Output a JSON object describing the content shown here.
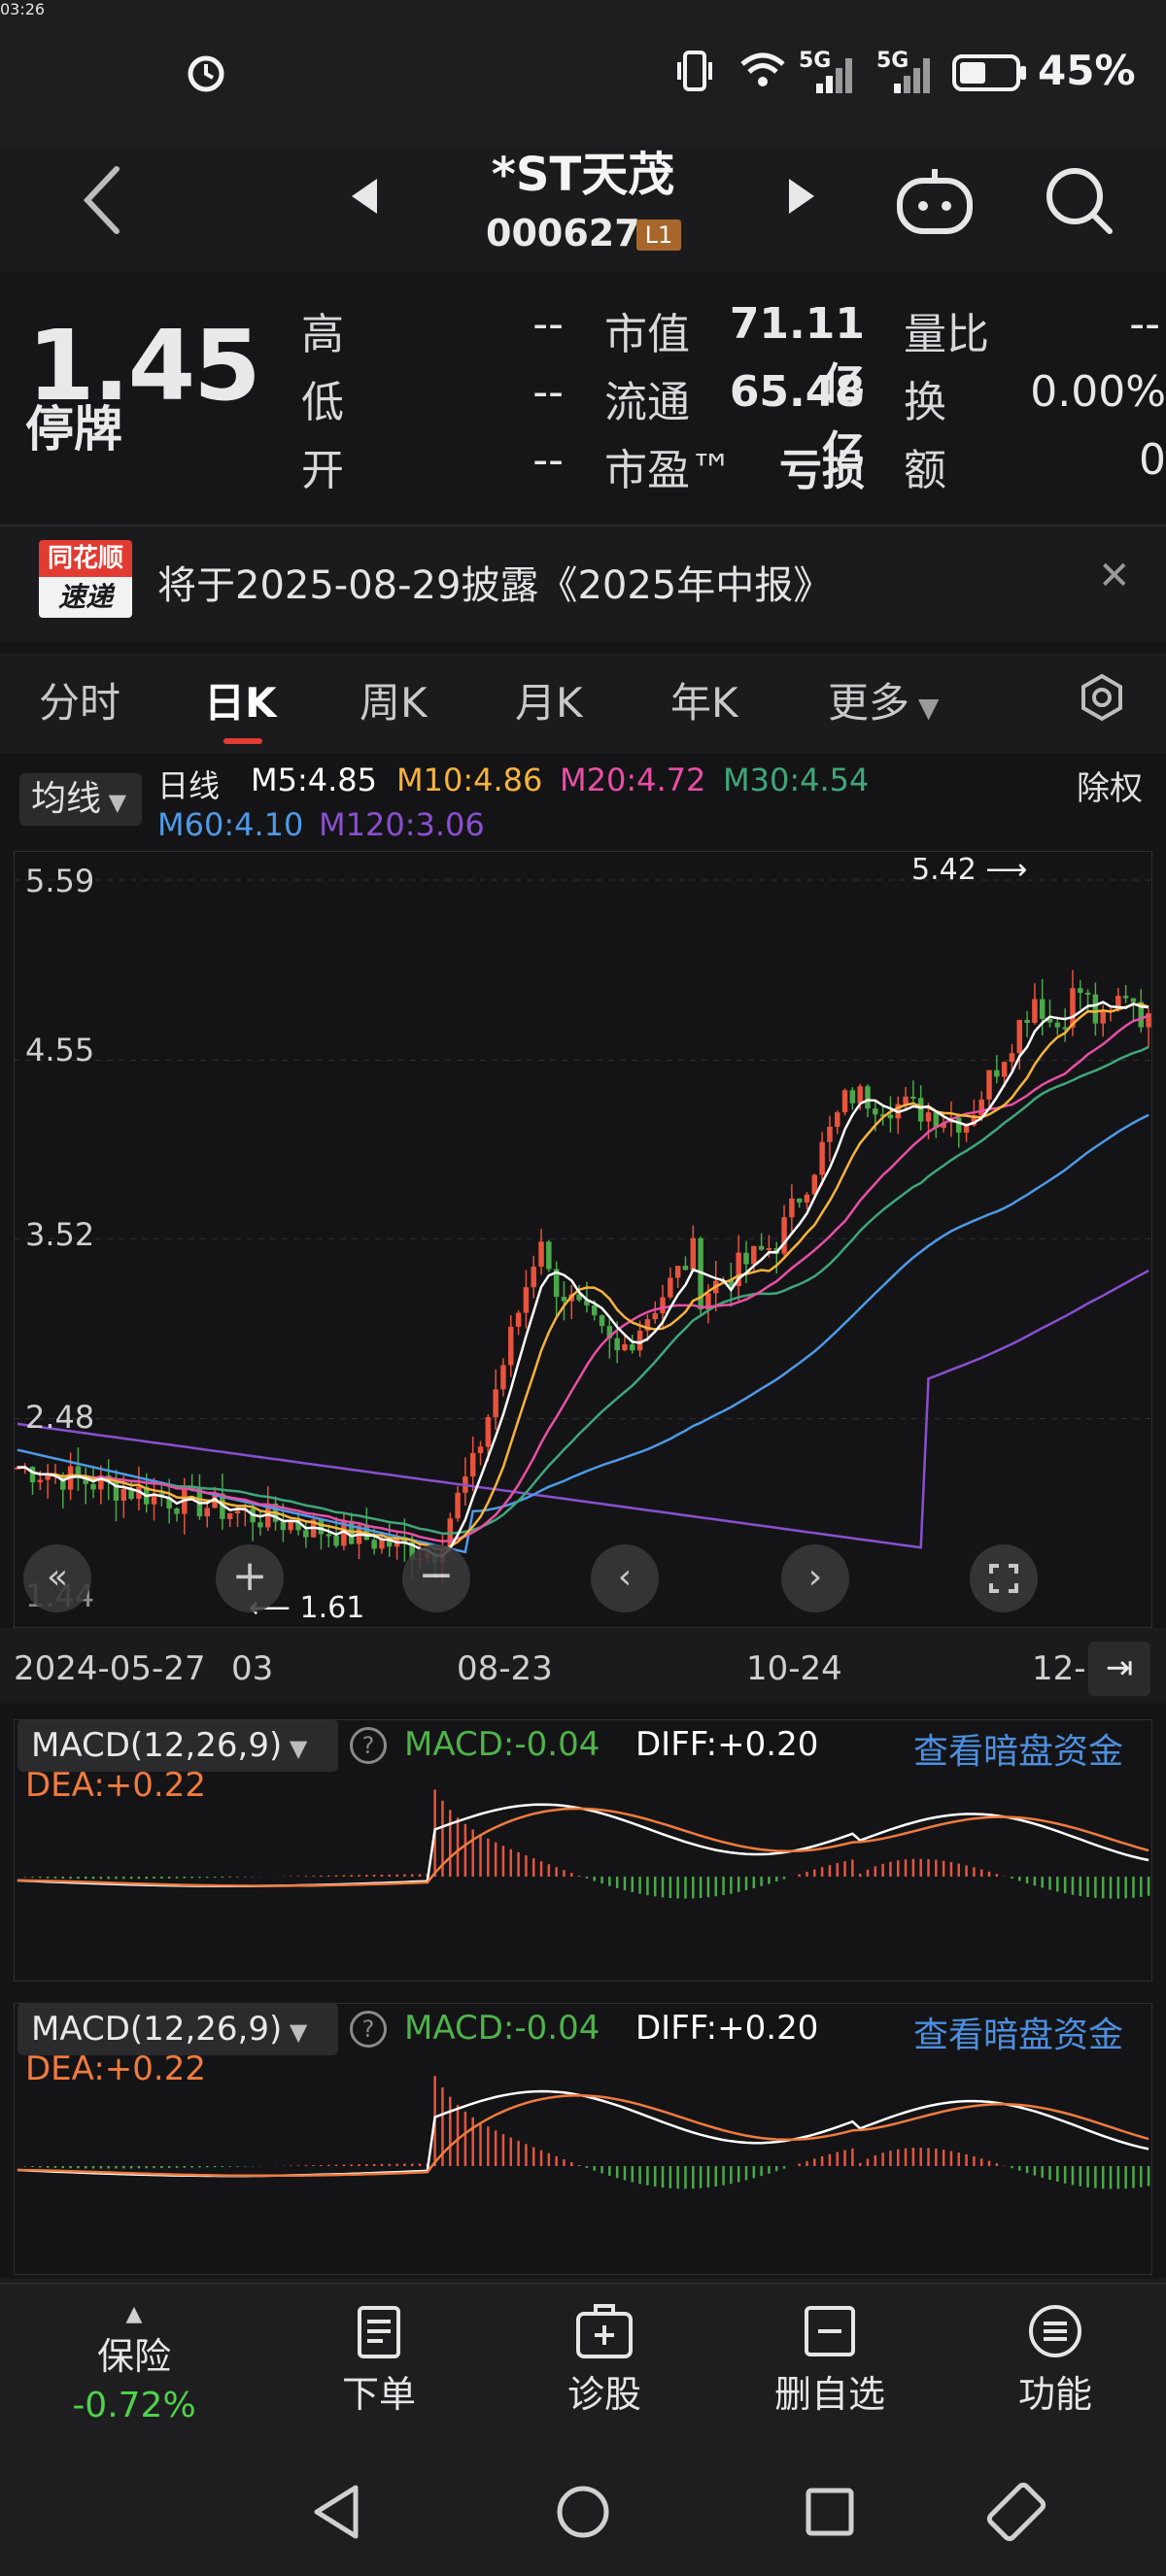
{
  "status_bar": {
    "time": "03:26",
    "battery": "45%",
    "network1": "5G",
    "network2": "5G"
  },
  "header": {
    "title": "*ST天茂",
    "code": "000627",
    "level_badge": "L1"
  },
  "quote": {
    "price": "1.45",
    "state": "停牌",
    "rows": [
      {
        "l1": "高",
        "v1": "--",
        "l2": "市值",
        "v2": "71.11亿",
        "l3": "量比",
        "v3": "--"
      },
      {
        "l1": "低",
        "v1": "--",
        "l2": "流通",
        "v2": "65.48亿",
        "l3": "换",
        "v3": "0.00%"
      },
      {
        "l1": "开",
        "v1": "--",
        "l2": "市盈™",
        "v2": "亏损",
        "l3": "额",
        "v3": "0"
      }
    ]
  },
  "notice": {
    "logo_top": "同花顺",
    "logo_bottom": "速递",
    "text": "将于2025-08-29披露《2025年中报》"
  },
  "tabs": [
    "分时",
    "日K",
    "周K",
    "月K",
    "年K",
    "更多"
  ],
  "active_tab": "日K",
  "ma_bar": {
    "button": "均线",
    "period": "日线",
    "m5": "M5:4.85",
    "m10": "M10:4.86",
    "m20": "M20:4.72",
    "m30": "M30:4.54",
    "m60": "M60:4.10",
    "m120": "M120:3.06",
    "fuquan": "除权"
  },
  "colors": {
    "up": "#e8533e",
    "down": "#4ba84a",
    "m5": "#ffffff",
    "m10": "#f7b33c",
    "m20": "#e84fa6",
    "m30": "#3fa77a",
    "m60": "#4e9ae8",
    "m120": "#8a4fd0",
    "link": "#4d8fe0"
  },
  "chart_data": {
    "type": "candlestick",
    "y_ticks": [
      "5.59",
      "4.55",
      "3.52",
      "2.48",
      "1.44"
    ],
    "ylim": [
      1.44,
      5.59
    ],
    "max_label": "5.42",
    "min_label": "1.61",
    "x_ticks": [
      "2024-05-27",
      "03",
      "08-23",
      "10-24",
      "12-"
    ],
    "ma_close_values": {
      "M5": 4.85,
      "M10": 4.86,
      "M20": 4.72,
      "M30": 4.54,
      "M60": 4.1,
      "M120": 3.06
    }
  },
  "macd_panels": [
    {
      "button": "MACD(12,26,9)",
      "macd": "MACD:-0.04",
      "diff": "DIFF:+0.20",
      "dea": "DEA:+0.22",
      "link": "查看暗盘资金"
    },
    {
      "button": "MACD(12,26,9)",
      "macd": "MACD:-0.04",
      "diff": "DIFF:+0.20",
      "dea": "DEA:+0.22",
      "link": "查看暗盘资金"
    }
  ],
  "bottom_bar": [
    {
      "label": "保险",
      "sub": "-0.72%",
      "icon": "chevron-up-icon"
    },
    {
      "label": "下单",
      "icon": "order-icon"
    },
    {
      "label": "诊股",
      "icon": "diagnose-icon"
    },
    {
      "label": "删自选",
      "icon": "remove-watchlist-icon"
    },
    {
      "label": "功能",
      "icon": "menu-icon"
    }
  ]
}
